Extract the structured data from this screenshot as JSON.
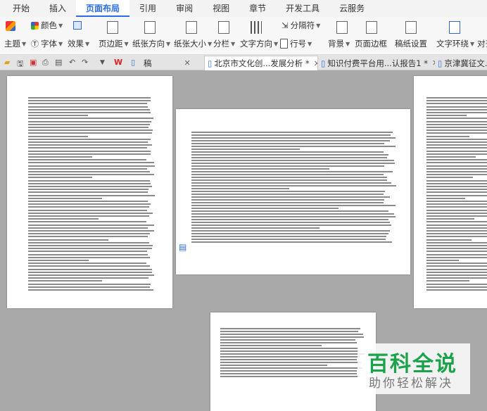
{
  "menubar": {
    "tabs": [
      "开始",
      "插入",
      "页面布局",
      "引用",
      "审阅",
      "视图",
      "章节",
      "开发工具",
      "云服务"
    ],
    "active": "页面布局"
  },
  "ribbon": {
    "color_label": "颜色",
    "theme_label": "主题",
    "font_label": "字体",
    "effect_label": "效果",
    "margins_label": "页边距",
    "orientation_label": "纸张方向",
    "size_label": "纸张大小",
    "columns_label": "分栏",
    "text_direction_label": "文字方向",
    "line_number_label": "行号",
    "breaks_label": "分隔符",
    "background_label": "背景",
    "page_border_label": "页面边框",
    "manuscript_label": "稿纸设置",
    "text_wrap_label": "文字环绕",
    "align_label": "对齐"
  },
  "tabs": {
    "t1": "稿",
    "t2": "北京市文化创...发展分析 *",
    "t3": "知识付费平台用...认报告1 *",
    "t4": "京津冀征文..."
  },
  "watermark": {
    "title": "百科全说",
    "subtitle": "助你轻松解决"
  }
}
